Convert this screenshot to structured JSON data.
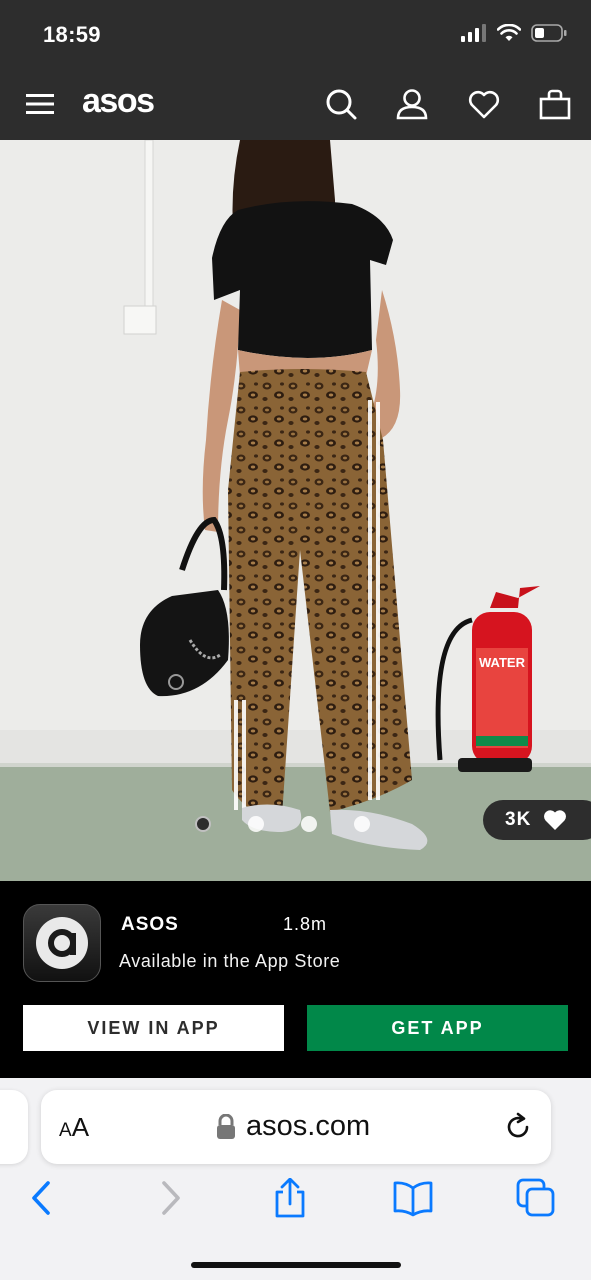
{
  "status_bar": {
    "time": "18:59"
  },
  "header": {
    "logo": "asos",
    "icons": [
      "menu-icon",
      "search-icon",
      "account-icon",
      "heart-icon",
      "bag-icon"
    ]
  },
  "product": {
    "image_description": "model in black crop top and leopard print wide-leg trousers with side stripes, holding a black bag, beside a red fire extinguisher",
    "image_count": 4,
    "active_image_index": 0,
    "like_count": "3K",
    "extinguisher_label": "WATER"
  },
  "app_banner": {
    "app_name": "ASOS",
    "app_size": "1.8m",
    "subtitle": "Available in the App Store",
    "view_button": "VIEW IN APP",
    "get_button": "GET APP",
    "get_button_color": "#018849"
  },
  "browser": {
    "text_size_label": "AA",
    "url": "asos.com",
    "accent_color": "#0a7aff",
    "toolbar_icons": [
      "back-icon",
      "forward-icon",
      "share-icon",
      "bookmarks-icon",
      "tabs-icon"
    ]
  }
}
